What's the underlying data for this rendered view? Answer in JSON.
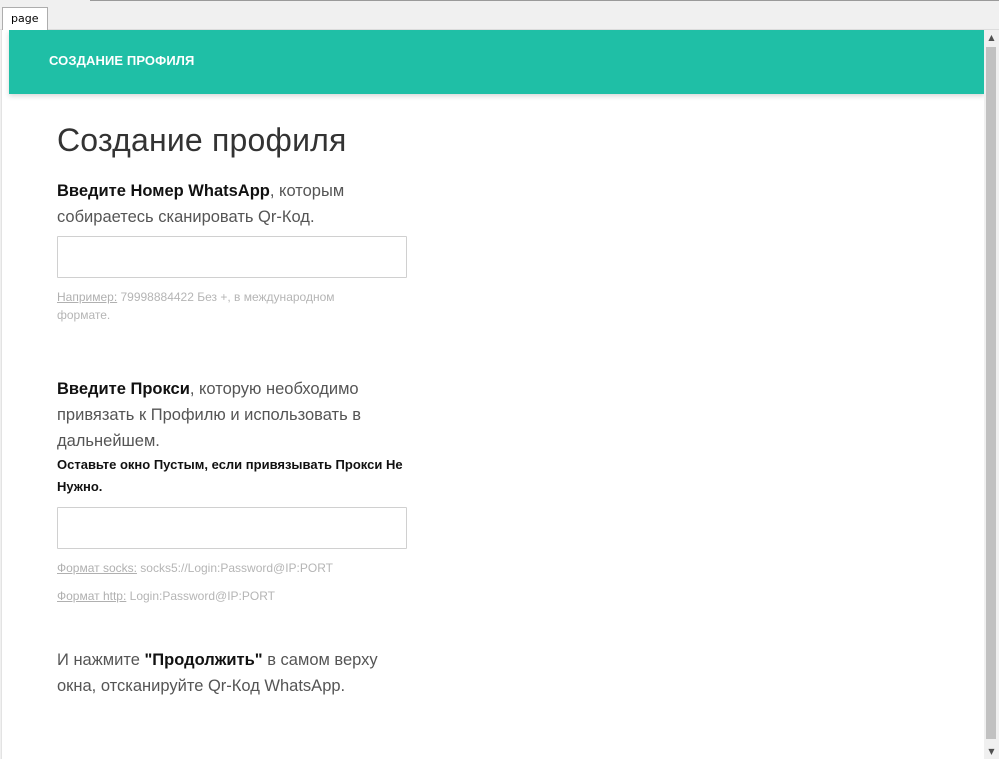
{
  "window": {
    "tab_label": "page"
  },
  "header": {
    "title": "СОЗДАНИЕ ПРОФИЛЯ"
  },
  "main": {
    "title": "Создание профиля",
    "whatsapp": {
      "label_bold": "Введите Номер WhatsApp",
      "label_rest": ", которым собираетесь сканировать Qr-Код.",
      "input_value": "",
      "input_placeholder": "",
      "hint_label": "Например:",
      "hint_text": " 79998884422 Без +, в международном формате."
    },
    "proxy": {
      "label_bold": "Введите Прокси",
      "label_rest": ", которую необходимо привязать к Профилю и использовать в дальнейшем.",
      "note": "Оставьте окно Пустым, если привязывать Прокси Не Нужно.",
      "input_value": "",
      "input_placeholder": "",
      "socks_label": "Формат socks:",
      "socks_text": " socks5://Login:Password@IP:PORT",
      "http_label": "Формат http:",
      "http_text": " Login:Password@IP:PORT"
    },
    "footer": {
      "prefix": "И нажмите ",
      "bold": "\"Продолжить\"",
      "suffix": " в самом верху окна, отсканируйте Qr-Код WhatsApp."
    }
  },
  "colors": {
    "header_bg": "#1fbfa6",
    "header_text": "#ffffff"
  },
  "icons": {
    "scroll_up": "▲",
    "scroll_down": "▼"
  }
}
